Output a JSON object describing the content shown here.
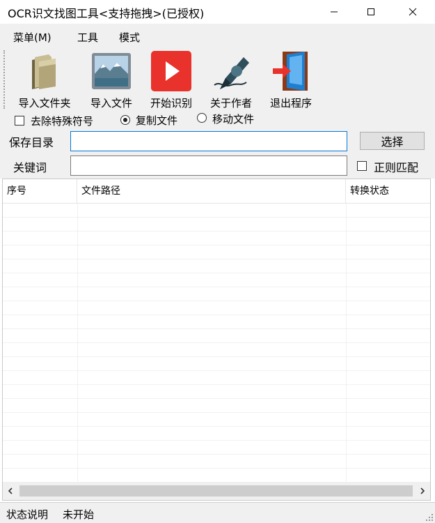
{
  "window": {
    "title": "OCR识文找图工具<支持拖拽>(已授权)"
  },
  "menu": {
    "items": [
      "菜单(M)",
      "工具",
      "模式"
    ]
  },
  "toolbar": {
    "buttons": [
      {
        "label": "导入文件夹",
        "icon": "folder-icon"
      },
      {
        "label": "导入文件",
        "icon": "image-file-icon"
      },
      {
        "label": "开始识别",
        "icon": "play-icon"
      },
      {
        "label": "关于作者",
        "icon": "pen-icon"
      },
      {
        "label": "退出程序",
        "icon": "exit-door-icon"
      }
    ]
  },
  "options": {
    "remove_special_chars": {
      "label": "去除特殊符号",
      "checked": false
    },
    "mode": {
      "selected": "copy",
      "choices": [
        {
          "id": "copy",
          "label": "复制文件"
        },
        {
          "id": "move",
          "label": "移动文件"
        }
      ]
    }
  },
  "form": {
    "save_dir": {
      "label": "保存目录",
      "value": "",
      "placeholder": ""
    },
    "browse_button": "选择",
    "keyword": {
      "label": "关键词",
      "value": "",
      "placeholder": ""
    },
    "regex": {
      "label": "正则匹配",
      "checked": false
    }
  },
  "table": {
    "columns": [
      "序号",
      "文件路径",
      "转换状态"
    ],
    "rows": []
  },
  "status": {
    "label": "状态说明",
    "value": "未开始"
  },
  "colors": {
    "focus_border": "#0078d7",
    "play_red": "#e8322b",
    "chrome_gray": "#f0f0f0"
  }
}
